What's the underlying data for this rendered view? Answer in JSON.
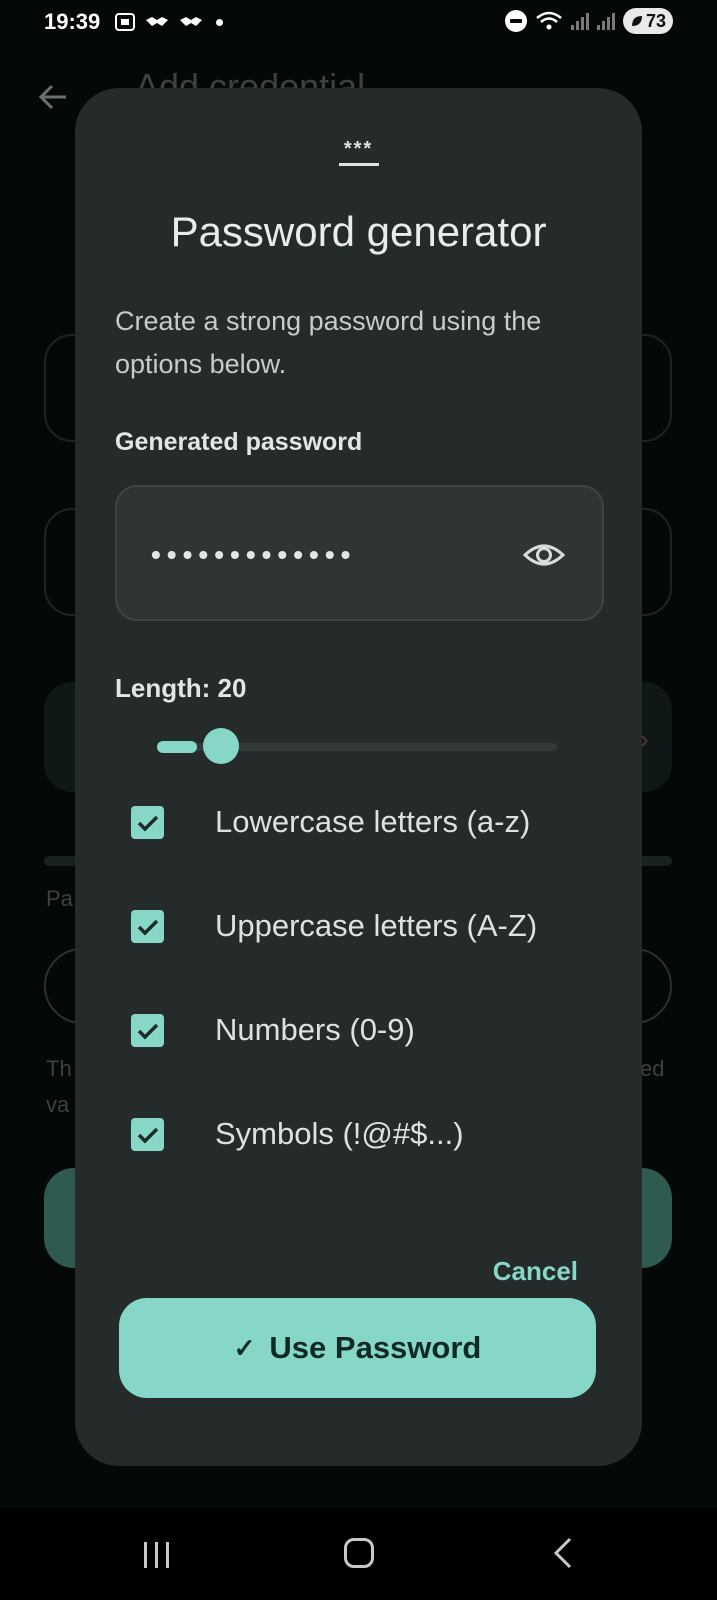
{
  "status_bar": {
    "time": "19:39",
    "battery": "73",
    "icons": [
      "screenshot-icon",
      "handshake-icon",
      "handshake-icon",
      "dot-icon",
      "dnd-icon",
      "wifi-icon",
      "signal-icon",
      "signal-icon",
      "battery-icon"
    ]
  },
  "background": {
    "title": "Add credential",
    "field_label": "Pa",
    "help_left_1": "Th",
    "help_left_2": "va",
    "help_right": "ed",
    "arrow": "›"
  },
  "dialog": {
    "icon_text": "***",
    "title": "Password generator",
    "description": "Create a strong password using the options below.",
    "generated_label": "Generated password",
    "password_masked": "•••••••••••••",
    "length_label": "Length: 20",
    "length_value": 20,
    "length_fraction": 0.1,
    "options": [
      {
        "label": "Lowercase letters (a-z)",
        "checked": true
      },
      {
        "label": "Uppercase letters (A-Z)",
        "checked": true
      },
      {
        "label": "Numbers (0-9)",
        "checked": true
      },
      {
        "label": "Symbols (!@#$...)",
        "checked": true
      }
    ],
    "cancel_label": "Cancel",
    "use_label": "Use Password",
    "use_check": "✓"
  },
  "colors": {
    "accent": "#86d7c8",
    "dialog_bg": "#252b2a",
    "page_bg": "#050808"
  }
}
